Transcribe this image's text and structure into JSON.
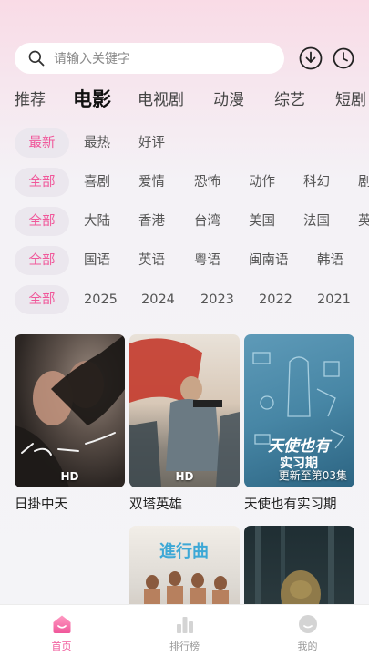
{
  "search": {
    "placeholder": "请输入关键字"
  },
  "category_tabs": [
    "推荐",
    "电影",
    "电视剧",
    "动漫",
    "综艺",
    "短剧"
  ],
  "category_active": "电影",
  "filters": {
    "sort": [
      "最新",
      "最热",
      "好评"
    ],
    "genre": [
      "全部",
      "喜剧",
      "爱情",
      "恐怖",
      "动作",
      "科幻",
      "剧"
    ],
    "region": [
      "全部",
      "大陆",
      "香港",
      "台湾",
      "美国",
      "法国",
      "英"
    ],
    "language": [
      "全部",
      "国语",
      "英语",
      "粤语",
      "闽南语",
      "韩语"
    ],
    "year": [
      "全部",
      "2025",
      "2024",
      "2023",
      "2022",
      "2021"
    ]
  },
  "movies": [
    {
      "title": "日掛中天",
      "badge": "HD"
    },
    {
      "title": "双塔英雄",
      "badge": "HD"
    },
    {
      "title": "天使也有实习期",
      "badge": "更新至第03集"
    },
    {
      "title": "",
      "badge": ""
    },
    {
      "title": "",
      "badge": ""
    }
  ],
  "bottom_nav": [
    "首页",
    "排行榜",
    "我的"
  ],
  "colors": {
    "accent": "#f0579a",
    "chip_bg": "#ebe7ee"
  }
}
